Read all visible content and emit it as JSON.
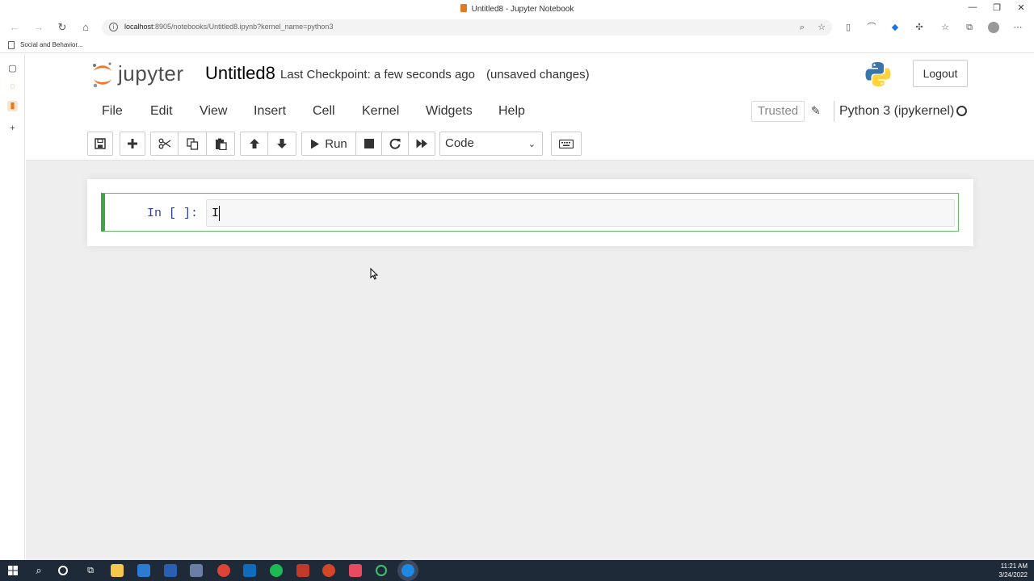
{
  "window": {
    "title": "Untitled8 - Jupyter Notebook",
    "controls": {
      "minimize": "—",
      "restore": "❐",
      "close": "✕"
    }
  },
  "browser": {
    "url_host": "localhost",
    "url_rest": ":8905/notebooks/Untitled8.ipynb?kernel_name=python3",
    "bookmark": "Social and Behavior..."
  },
  "jupyter": {
    "logo_text": "jupyter",
    "notebook_name": "Untitled8",
    "checkpoint": "Last Checkpoint: a few seconds ago",
    "unsaved": "(unsaved changes)",
    "logout_label": "Logout",
    "menu": [
      "File",
      "Edit",
      "View",
      "Insert",
      "Cell",
      "Kernel",
      "Widgets",
      "Help"
    ],
    "trusted_label": "Trusted",
    "kernel_name": "Python 3 (ipykernel)",
    "toolbar": {
      "run_label": "Run",
      "cell_type": "Code"
    },
    "cell": {
      "prompt": "In [ ]:",
      "input": "I"
    },
    "colors": {
      "logo_orange": "#f37726",
      "cell_selected_border": "#42a545",
      "prompt": "#303f9f"
    }
  },
  "taskbar": {
    "time": "11:21 AM",
    "date": "3/24/2022"
  }
}
